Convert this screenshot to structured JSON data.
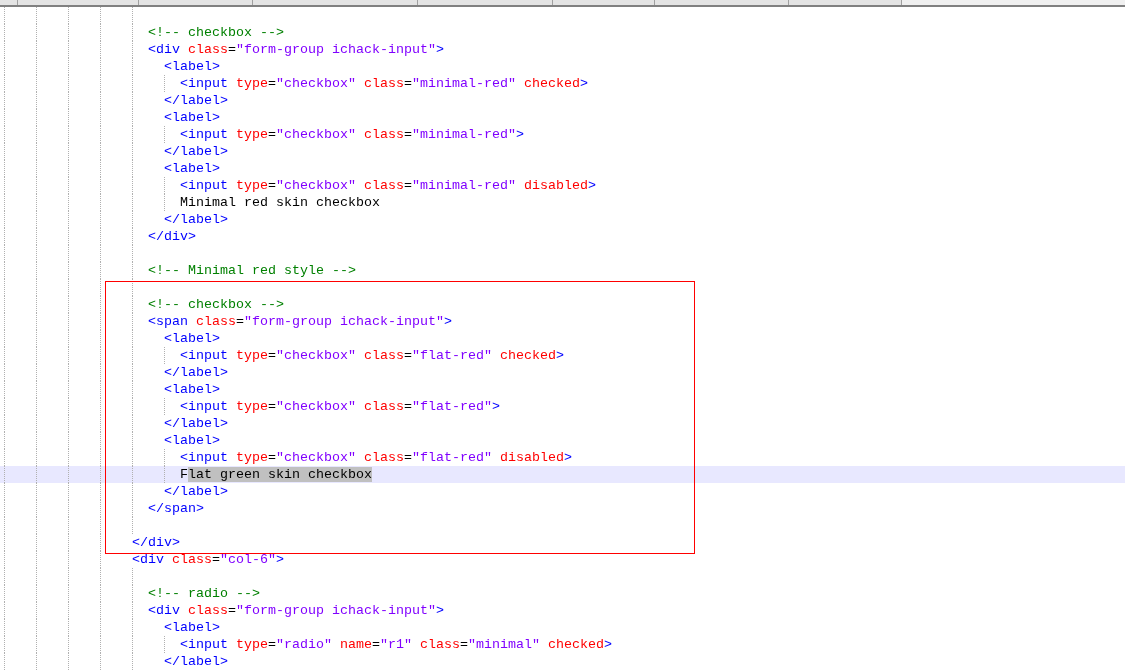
{
  "editor": {
    "annotations": [
      {
        "kind": "rectangle"
      }
    ],
    "lines": [
      {
        "kind": "group",
        "children": [
          {
            "kind": "blank",
            "current": false
          },
          {
            "kind": "code",
            "tokens": [
              {
                "kind": "comment",
                "text": "<!-- checkbox -->"
              }
            ],
            "current": false
          },
          {
            "kind": "code",
            "tokens": [
              {
                "kind": "tag",
                "text": "<div"
              },
              {
                "kind": "attr",
                "text": " class"
              },
              {
                "kind": "op",
                "text": "="
              },
              {
                "kind": "value",
                "text": "\"form-group ichack-input\""
              },
              {
                "kind": "tag",
                "text": ">"
              }
            ],
            "current": false,
            "children": [
              {
                "kind": "code",
                "tokens": [
                  {
                    "kind": "tag",
                    "text": "<label>"
                  }
                ],
                "current": false,
                "children": [
                  {
                    "kind": "code",
                    "tokens": [
                      {
                        "kind": "tag",
                        "text": "<input"
                      },
                      {
                        "kind": "attr",
                        "text": " type"
                      },
                      {
                        "kind": "op",
                        "text": "="
                      },
                      {
                        "kind": "value",
                        "text": "\"checkbox\""
                      },
                      {
                        "kind": "attr",
                        "text": " class"
                      },
                      {
                        "kind": "op",
                        "text": "="
                      },
                      {
                        "kind": "value",
                        "text": "\"minimal-red\""
                      },
                      {
                        "kind": "attr",
                        "text": " checked"
                      },
                      {
                        "kind": "tag",
                        "text": ">"
                      }
                    ],
                    "current": false
                  }
                ]
              },
              {
                "kind": "code",
                "tokens": [
                  {
                    "kind": "tag",
                    "text": "</label>"
                  }
                ],
                "current": false
              },
              {
                "kind": "code",
                "tokens": [
                  {
                    "kind": "tag",
                    "text": "<label>"
                  }
                ],
                "current": false,
                "children": [
                  {
                    "kind": "code",
                    "tokens": [
                      {
                        "kind": "tag",
                        "text": "<input"
                      },
                      {
                        "kind": "attr",
                        "text": " type"
                      },
                      {
                        "kind": "op",
                        "text": "="
                      },
                      {
                        "kind": "value",
                        "text": "\"checkbox\""
                      },
                      {
                        "kind": "attr",
                        "text": " class"
                      },
                      {
                        "kind": "op",
                        "text": "="
                      },
                      {
                        "kind": "value",
                        "text": "\"minimal-red\""
                      },
                      {
                        "kind": "tag",
                        "text": ">"
                      }
                    ],
                    "current": false
                  }
                ]
              },
              {
                "kind": "code",
                "tokens": [
                  {
                    "kind": "tag",
                    "text": "</label>"
                  }
                ],
                "current": false
              },
              {
                "kind": "code",
                "tokens": [
                  {
                    "kind": "tag",
                    "text": "<label>"
                  }
                ],
                "current": false,
                "children": [
                  {
                    "kind": "code",
                    "tokens": [
                      {
                        "kind": "tag",
                        "text": "<input"
                      },
                      {
                        "kind": "attr",
                        "text": " type"
                      },
                      {
                        "kind": "op",
                        "text": "="
                      },
                      {
                        "kind": "value",
                        "text": "\"checkbox\""
                      },
                      {
                        "kind": "attr",
                        "text": " class"
                      },
                      {
                        "kind": "op",
                        "text": "="
                      },
                      {
                        "kind": "value",
                        "text": "\"minimal-red\""
                      },
                      {
                        "kind": "attr",
                        "text": " disabled"
                      },
                      {
                        "kind": "tag",
                        "text": ">"
                      }
                    ],
                    "current": false
                  },
                  {
                    "kind": "code",
                    "tokens": [
                      {
                        "kind": "text",
                        "text": "Minimal red skin checkbox",
                        "selected": false
                      }
                    ],
                    "current": false
                  }
                ]
              },
              {
                "kind": "code",
                "tokens": [
                  {
                    "kind": "tag",
                    "text": "</label>"
                  }
                ],
                "current": false
              }
            ]
          },
          {
            "kind": "code",
            "tokens": [
              {
                "kind": "tag",
                "text": "</div>"
              }
            ],
            "current": false
          },
          {
            "kind": "blank",
            "current": false
          },
          {
            "kind": "code",
            "tokens": [
              {
                "kind": "comment",
                "text": "<!-- Minimal red style -->"
              }
            ],
            "current": false
          },
          {
            "kind": "blank",
            "current": false
          },
          {
            "kind": "code",
            "tokens": [
              {
                "kind": "comment",
                "text": "<!-- checkbox -->"
              }
            ],
            "current": false
          },
          {
            "kind": "code",
            "tokens": [
              {
                "kind": "tag",
                "text": "<span"
              },
              {
                "kind": "attr",
                "text": " class"
              },
              {
                "kind": "op",
                "text": "="
              },
              {
                "kind": "value",
                "text": "\"form-group ichack-input\""
              },
              {
                "kind": "tag",
                "text": ">"
              }
            ],
            "current": false,
            "children": [
              {
                "kind": "code",
                "tokens": [
                  {
                    "kind": "tag",
                    "text": "<label>"
                  }
                ],
                "current": false,
                "children": [
                  {
                    "kind": "code",
                    "tokens": [
                      {
                        "kind": "tag",
                        "text": "<input"
                      },
                      {
                        "kind": "attr",
                        "text": " type"
                      },
                      {
                        "kind": "op",
                        "text": "="
                      },
                      {
                        "kind": "value",
                        "text": "\"checkbox\""
                      },
                      {
                        "kind": "attr",
                        "text": " class"
                      },
                      {
                        "kind": "op",
                        "text": "="
                      },
                      {
                        "kind": "value",
                        "text": "\"flat-red\""
                      },
                      {
                        "kind": "attr",
                        "text": " checked"
                      },
                      {
                        "kind": "tag",
                        "text": ">"
                      }
                    ],
                    "current": false
                  }
                ]
              },
              {
                "kind": "code",
                "tokens": [
                  {
                    "kind": "tag",
                    "text": "</label>"
                  }
                ],
                "current": false
              },
              {
                "kind": "code",
                "tokens": [
                  {
                    "kind": "tag",
                    "text": "<label>"
                  }
                ],
                "current": false,
                "children": [
                  {
                    "kind": "code",
                    "tokens": [
                      {
                        "kind": "tag",
                        "text": "<input"
                      },
                      {
                        "kind": "attr",
                        "text": " type"
                      },
                      {
                        "kind": "op",
                        "text": "="
                      },
                      {
                        "kind": "value",
                        "text": "\"checkbox\""
                      },
                      {
                        "kind": "attr",
                        "text": " class"
                      },
                      {
                        "kind": "op",
                        "text": "="
                      },
                      {
                        "kind": "value",
                        "text": "\"flat-red\""
                      },
                      {
                        "kind": "tag",
                        "text": ">"
                      }
                    ],
                    "current": false
                  }
                ]
              },
              {
                "kind": "code",
                "tokens": [
                  {
                    "kind": "tag",
                    "text": "</label>"
                  }
                ],
                "current": false
              },
              {
                "kind": "code",
                "tokens": [
                  {
                    "kind": "tag",
                    "text": "<label>"
                  }
                ],
                "current": false,
                "children": [
                  {
                    "kind": "code",
                    "tokens": [
                      {
                        "kind": "tag",
                        "text": "<input"
                      },
                      {
                        "kind": "attr",
                        "text": " type"
                      },
                      {
                        "kind": "op",
                        "text": "="
                      },
                      {
                        "kind": "value",
                        "text": "\"checkbox\""
                      },
                      {
                        "kind": "attr",
                        "text": " class"
                      },
                      {
                        "kind": "op",
                        "text": "="
                      },
                      {
                        "kind": "value",
                        "text": "\"flat-red\""
                      },
                      {
                        "kind": "attr",
                        "text": " disabled"
                      },
                      {
                        "kind": "tag",
                        "text": ">"
                      }
                    ],
                    "current": false
                  },
                  {
                    "kind": "code",
                    "tokens": [
                      {
                        "kind": "text",
                        "text": "F",
                        "selected": false
                      },
                      {
                        "kind": "text",
                        "text": "lat green skin checkbox",
                        "selected": true
                      }
                    ],
                    "current": true
                  }
                ]
              },
              {
                "kind": "code",
                "tokens": [
                  {
                    "kind": "tag",
                    "text": "</label>"
                  }
                ],
                "current": false
              }
            ]
          },
          {
            "kind": "code",
            "tokens": [
              {
                "kind": "tag",
                "text": "</span>"
              }
            ],
            "current": false
          },
          {
            "kind": "blank",
            "current": false
          }
        ]
      },
      {
        "kind": "code",
        "tokens": [
          {
            "kind": "tag",
            "text": "</div>"
          }
        ],
        "current": false
      },
      {
        "kind": "code",
        "tokens": [
          {
            "kind": "tag",
            "text": "<div"
          },
          {
            "kind": "attr",
            "text": " class"
          },
          {
            "kind": "op",
            "text": "="
          },
          {
            "kind": "value",
            "text": "\"col-6\""
          },
          {
            "kind": "tag",
            "text": ">"
          }
        ],
        "current": false,
        "children": [
          {
            "kind": "blank",
            "current": false
          },
          {
            "kind": "code",
            "tokens": [
              {
                "kind": "comment",
                "text": "<!-- radio -->"
              }
            ],
            "current": false
          },
          {
            "kind": "code",
            "tokens": [
              {
                "kind": "tag",
                "text": "<div"
              },
              {
                "kind": "attr",
                "text": " class"
              },
              {
                "kind": "op",
                "text": "="
              },
              {
                "kind": "value",
                "text": "\"form-group ichack-input\""
              },
              {
                "kind": "tag",
                "text": ">"
              }
            ],
            "current": false,
            "children": [
              {
                "kind": "code",
                "tokens": [
                  {
                    "kind": "tag",
                    "text": "<label>"
                  }
                ],
                "current": false,
                "children": [
                  {
                    "kind": "code",
                    "tokens": [
                      {
                        "kind": "tag",
                        "text": "<input"
                      },
                      {
                        "kind": "attr",
                        "text": " type"
                      },
                      {
                        "kind": "op",
                        "text": "="
                      },
                      {
                        "kind": "value",
                        "text": "\"radio\""
                      },
                      {
                        "kind": "attr",
                        "text": " name"
                      },
                      {
                        "kind": "op",
                        "text": "="
                      },
                      {
                        "kind": "value",
                        "text": "\"r1\""
                      },
                      {
                        "kind": "attr",
                        "text": " class"
                      },
                      {
                        "kind": "op",
                        "text": "="
                      },
                      {
                        "kind": "value",
                        "text": "\"minimal\""
                      },
                      {
                        "kind": "attr",
                        "text": " checked"
                      },
                      {
                        "kind": "tag",
                        "text": ">"
                      }
                    ],
                    "current": false
                  }
                ]
              },
              {
                "kind": "code",
                "tokens": [
                  {
                    "kind": "tag",
                    "text": "</label>"
                  }
                ],
                "current": false
              }
            ]
          }
        ]
      }
    ]
  }
}
